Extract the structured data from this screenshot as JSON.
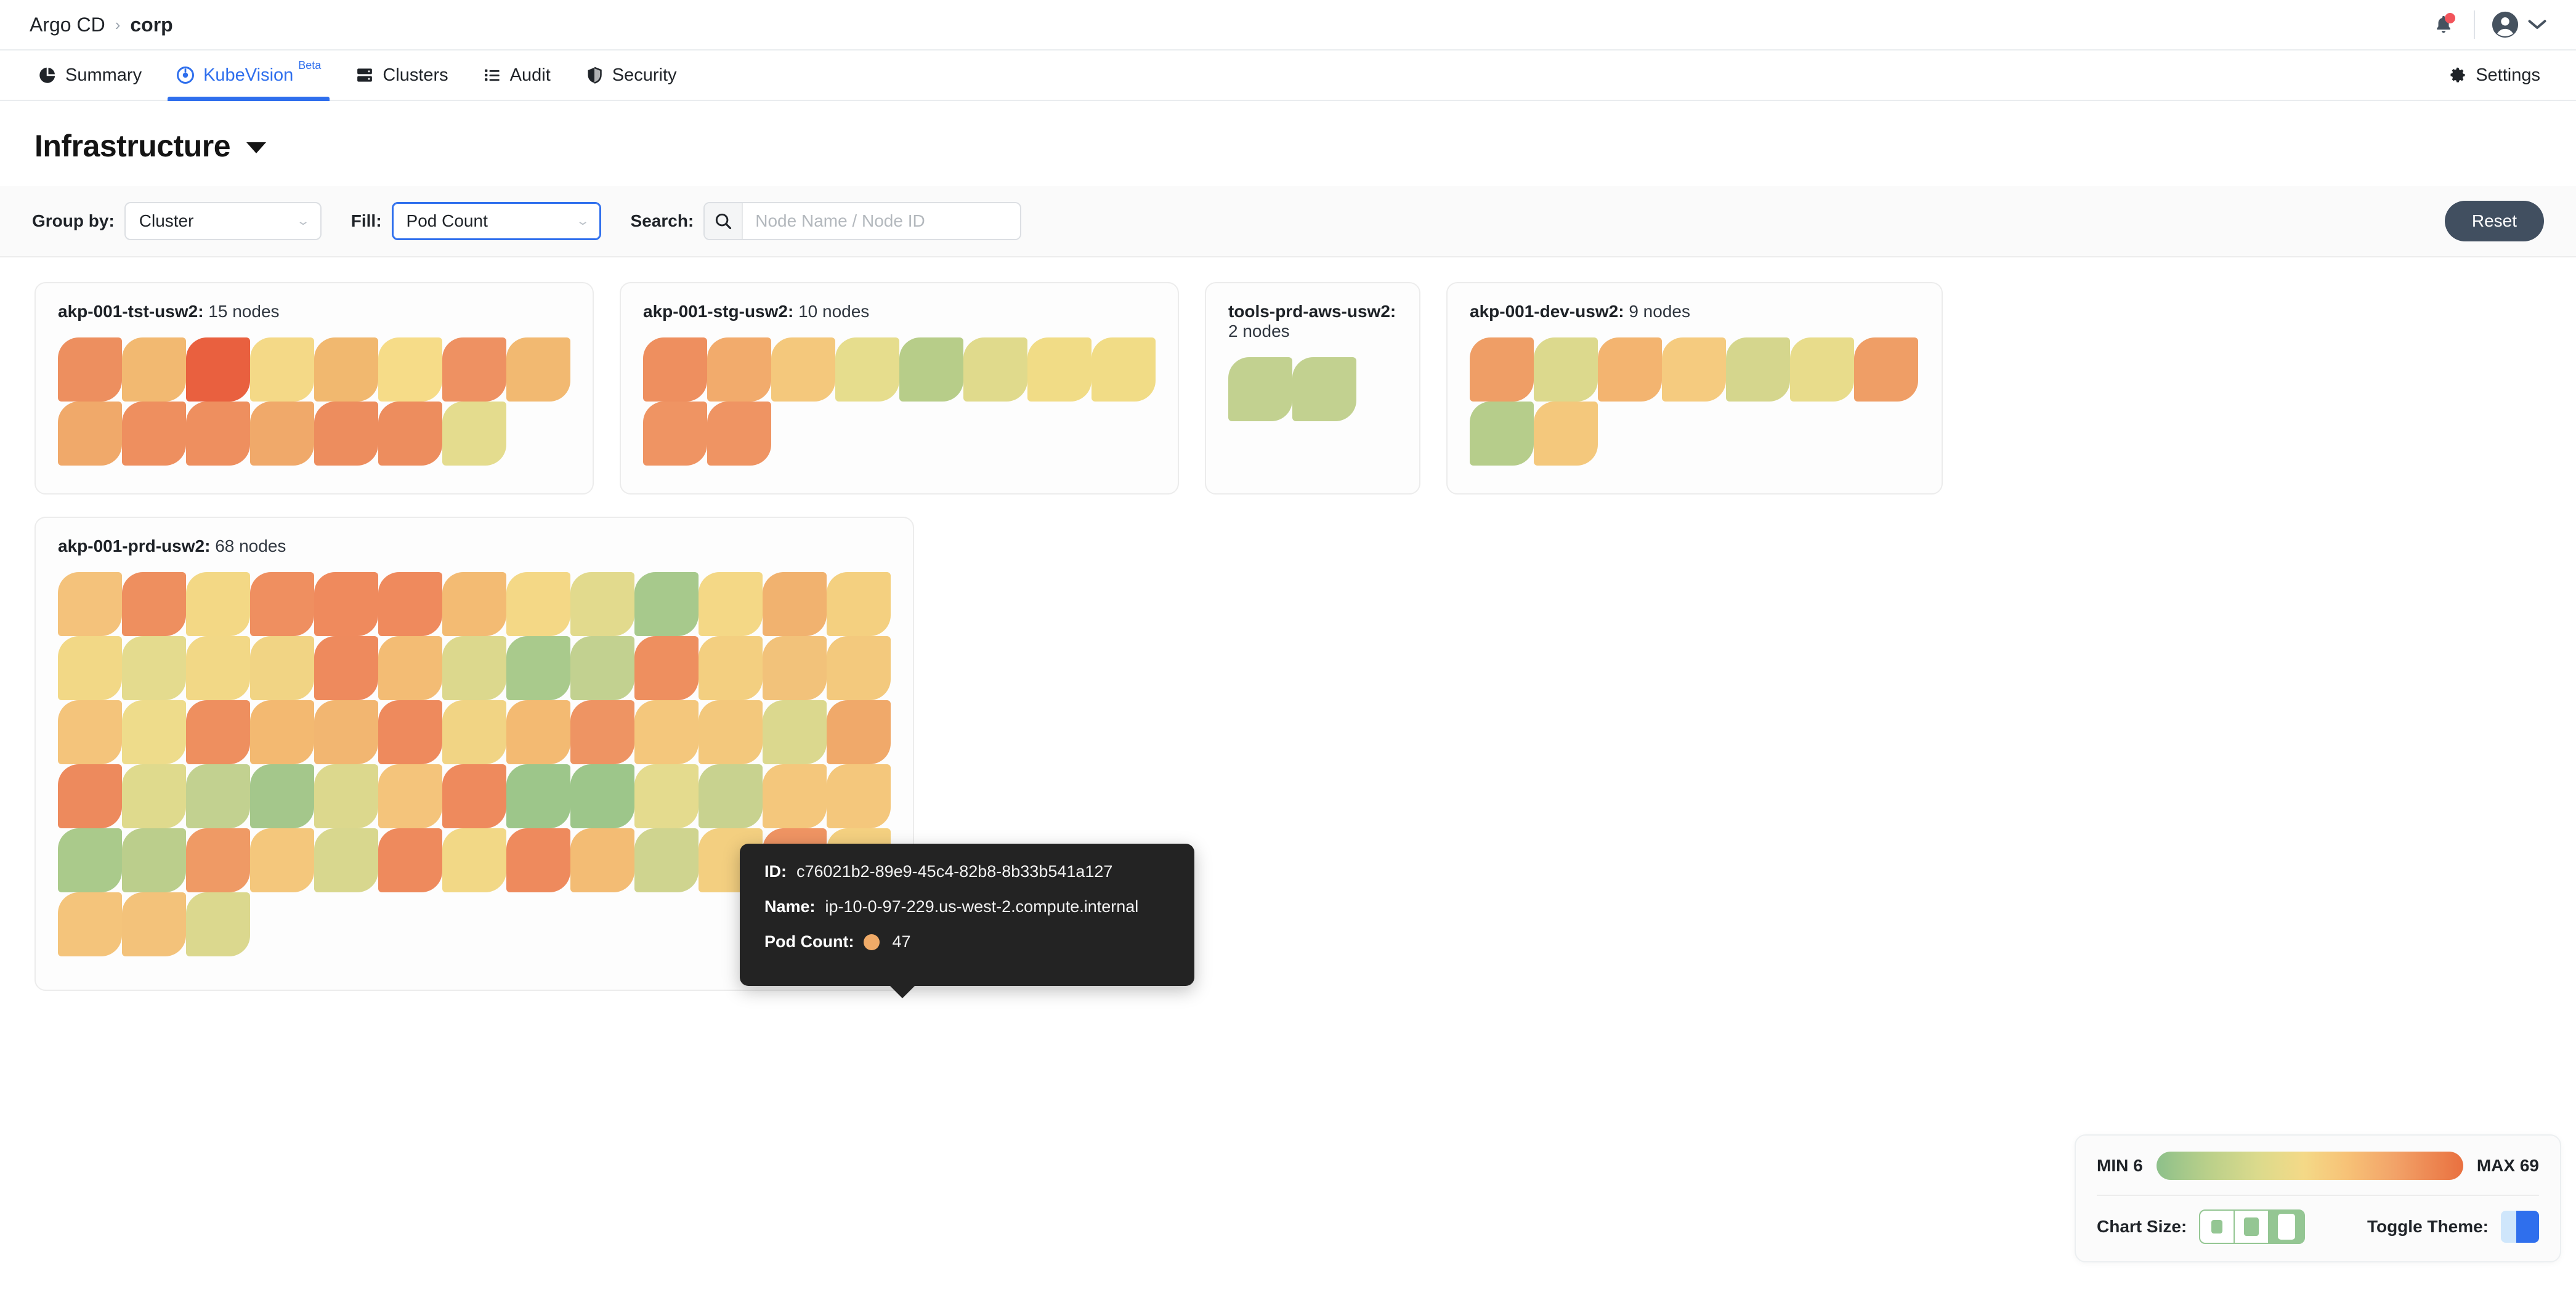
{
  "topbar": {
    "breadcrumb_root": "Argo CD",
    "breadcrumb_sep": "›",
    "breadcrumb_current": "corp",
    "notifications_icon": "bell-icon",
    "account_icon": "user-avatar-icon",
    "account_caret_icon": "chevron-down-icon"
  },
  "tabs": [
    {
      "label": "Summary",
      "icon": "pie-chart-icon",
      "active": false
    },
    {
      "label": "KubeVision",
      "icon": "eye-target-icon",
      "badge": "Beta",
      "active": true
    },
    {
      "label": "Clusters",
      "icon": "server-stack-icon",
      "active": false
    },
    {
      "label": "Audit",
      "icon": "list-icon",
      "active": false
    },
    {
      "label": "Security",
      "icon": "shield-icon",
      "active": false
    }
  ],
  "settings": {
    "label": "Settings",
    "icon": "gear-icon"
  },
  "page": {
    "title": "Infrastructure",
    "title_caret_icon": "caret-down-icon"
  },
  "toolbar": {
    "group_by_label": "Group by:",
    "group_by_value": "Cluster",
    "fill_label": "Fill:",
    "fill_value": "Pod Count",
    "search_label": "Search:",
    "search_icon": "search-icon",
    "search_value": "",
    "search_placeholder": "Node Name / Node ID",
    "reset_label": "Reset",
    "select_caret_icon": "chevron-down-icon"
  },
  "tooltip": {
    "id_key": "ID:",
    "id_value": "c76021b2-89e9-45c4-82b8-8b33b541a127",
    "name_key": "Name:",
    "name_value": "ip-10-0-97-229.us-west-2.compute.internal",
    "podcount_key": "Pod Count:",
    "podcount_value": "47",
    "podcount_swatch_color": "#f0ab68"
  },
  "legend": {
    "min_label": "MIN 6",
    "max_label": "MAX 69",
    "chart_size_label": "Chart Size:",
    "chart_size_selected_index": 2,
    "toggle_theme_label": "Toggle Theme:",
    "gradient_start": "#8dc08a",
    "gradient_end": "#e9703f"
  },
  "chart_data": {
    "type": "heatmap",
    "title": "Infrastructure",
    "group_by": "Cluster",
    "fill_metric": "Pod Count",
    "value_min": 6,
    "value_max": 69,
    "color_scale": [
      "#8dc08a",
      "#b8cf8a",
      "#dbda8c",
      "#f4d987",
      "#f7c277",
      "#f2a268",
      "#e9703f"
    ],
    "clusters": [
      {
        "name": "akp-001-tst-usw2",
        "node_count_label": "15 nodes",
        "node_count": 15,
        "columns": 8,
        "node_colors": [
          "#ed8f5f",
          "#f2b971",
          "#e9603f",
          "#f4d987",
          "#f1b86f",
          "#f6dc88",
          "#ee9162",
          "#f2b971",
          "#f0a96a",
          "#ee8f5f",
          "#ee8f5f",
          "#f0a96a",
          "#ed8d5e",
          "#ed8d5e",
          "#e4dc8e"
        ]
      },
      {
        "name": "akp-001-stg-usw2",
        "node_count_label": "10 nodes",
        "node_count": 10,
        "columns": 8,
        "node_colors": [
          "#ee8f5f",
          "#f2ab6c",
          "#f4c87c",
          "#e6dd8d",
          "#b7cd89",
          "#e0da8c",
          "#f1dc86",
          "#f1dc86",
          "#ef9463",
          "#ef9463"
        ]
      },
      {
        "name": "tools-prd-aws-usw2",
        "node_count_label": "2 nodes",
        "node_count": 2,
        "columns": 2,
        "node_colors": [
          "#c2d190",
          "#c2d190"
        ]
      },
      {
        "name": "akp-001-dev-usw2",
        "node_count_label": "9 nodes",
        "node_count": 9,
        "columns": 7,
        "node_colors": [
          "#ef9e66",
          "#dcd98d",
          "#f3b470",
          "#f5cb7f",
          "#d5d68d",
          "#e8dc8b",
          "#ef9e66",
          "#b6cd8b",
          "#f4c87c"
        ]
      },
      {
        "name": "akp-001-prd-usw2",
        "node_count_label": "68 nodes",
        "node_count": 68,
        "columns": 13,
        "node_colors": [
          "#f4c27b",
          "#ee8f5f",
          "#f3d885",
          "#ef8f60",
          "#ef8a5d",
          "#ef8a5d",
          "#f3bb73",
          "#f4d886",
          "#e2da8d",
          "#a7c98c",
          "#f4d886",
          "#f1b26f",
          "#f4d080",
          "#f2d886",
          "#e4db8e",
          "#f2d886",
          "#f1d484",
          "#ee8a5d",
          "#f3bc74",
          "#dcd88d",
          "#a9ca8c",
          "#c2d190",
          "#ee8f5f",
          "#f3cf80",
          "#f2c27a",
          "#f3c97d",
          "#f4c47b",
          "#eedc8b",
          "#ee8f5f",
          "#f3b971",
          "#f2b671",
          "#ee8a5d",
          "#f1d484",
          "#f3ba72",
          "#ee9463",
          "#f4c77c",
          "#f3c87c",
          "#dbd88e",
          "#f0a96a",
          "#ed8a5d",
          "#dfda8d",
          "#c2d190",
          "#a4c78b",
          "#dcd88d",
          "#f4c47b",
          "#ee8a5d",
          "#9dc68a",
          "#9dc68a",
          "#e4db8e",
          "#c8d28f",
          "#f4c77c",
          "#f4c77c",
          "#aaca8b",
          "#bbce8c",
          "#ef9a65",
          "#f4c77c",
          "#d8d78e",
          "#ee8a5d",
          "#f2d886",
          "#ee8a5d",
          "#f3bc74",
          "#cfd48f",
          "#f3cf80",
          "#ef9463",
          "#f4d080",
          "#f4c47b",
          "#f3c27a",
          "#dbd88e"
        ]
      }
    ]
  }
}
